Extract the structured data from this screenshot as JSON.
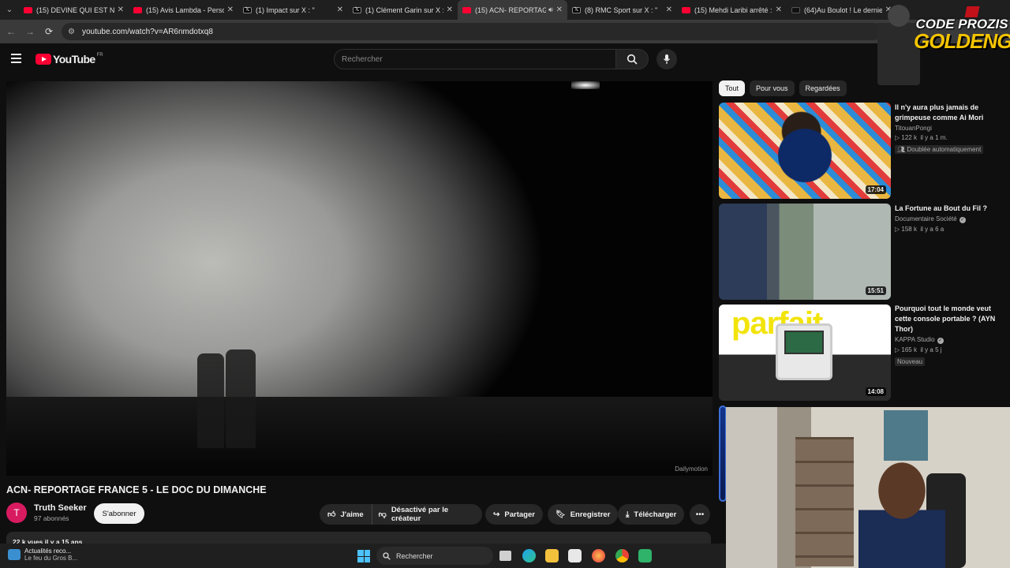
{
  "browser": {
    "tabs": [
      {
        "title": "(15) DEVINE QUI EST NAT",
        "favicon": "youtube-icon",
        "active": false
      },
      {
        "title": "(15) Avis Lambda - Person",
        "favicon": "youtube-icon",
        "active": false
      },
      {
        "title": "(1) Impact sur X : \"",
        "favicon": "x-icon",
        "active": false
      },
      {
        "title": "(1) Clément Garin sur X : \"",
        "favicon": "x-icon",
        "active": false
      },
      {
        "title": "(15) ACN- REPORTAG",
        "favicon": "youtube-icon",
        "active": true
      },
      {
        "title": "(8) RMC Sport sur X : \"",
        "favicon": "x-icon",
        "active": false
      },
      {
        "title": "(15) Mehdi Laribi arrêté :",
        "favicon": "youtube-icon",
        "active": false
      },
      {
        "title": "(64)Au Boulot ! Le dernie",
        "favicon": "tiktok-icon",
        "active": false
      }
    ],
    "url": "youtube.com/watch?v=AR6nmdotxq8"
  },
  "youtube": {
    "logo_text": "YouTube",
    "country_code": "FR",
    "search_placeholder": "Rechercher"
  },
  "video": {
    "title": "ACN- REPORTAGE FRANCE 5 - LE DOC DU DIMANCHE",
    "watermark": "Dailymotion",
    "channel_initial": "T",
    "channel_name": "Truth Seeker",
    "subscribers": "97 abonnés",
    "subscribe_label": "S'abonner",
    "like_label": "J'aime",
    "dislike_label": "Désactivé par le créateur",
    "share_label": "Partager",
    "save_label": "Enregistrer",
    "download_label": "Télécharger",
    "description_preview": "22 k vues  il y a 15 ans"
  },
  "sidebar": {
    "chips": [
      "Tout",
      "Pour vous",
      "Regardées"
    ],
    "recommendations": [
      {
        "title": "Il n'y aura plus jamais de grimpeuse comme Ai Mori",
        "channel": "TitouanPongi",
        "verified": false,
        "views": "122 k",
        "age": "il y a 1 m.",
        "duration": "17:04",
        "badge": "Doublée automatiquement"
      },
      {
        "title": "La Fortune au Bout du Fil ?",
        "channel": "Documentaire Société",
        "verified": true,
        "views": "158 k",
        "age": "il y a 6 a",
        "duration": "15:51",
        "badge": ""
      },
      {
        "title": "Pourquoi tout le monde veut cette console portable ? (AYN Thor)",
        "channel": "KAPPA Studio",
        "verified": true,
        "views": "165 k",
        "age": "il y a 5 j",
        "duration": "14:08",
        "badge": "Nouveau",
        "thumb_text": "parfait"
      }
    ]
  },
  "overlay": {
    "logo_line1": "CODE PROZIS",
    "logo_line2": "GOLDENG"
  },
  "taskbar": {
    "weather_title": "Actualités reco...",
    "weather_subtitle": "Le feu du Gros B...",
    "search_label": "Rechercher"
  }
}
